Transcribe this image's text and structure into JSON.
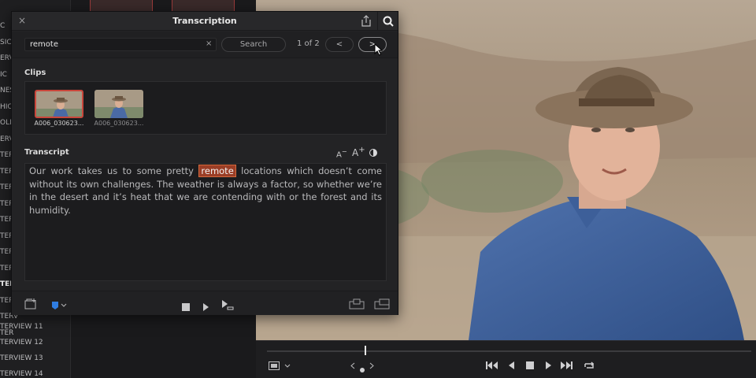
{
  "sidebar": {
    "items": [
      "C",
      "SIC",
      "ERVI",
      "IC",
      "NES",
      "HICS",
      "OLL",
      "ERVI",
      "TERV",
      "TERV",
      "TERV",
      "TERV",
      "TERV",
      "TERV",
      "TER",
      "TER",
      "TERV",
      "TERV",
      "TERV",
      "TER"
    ],
    "active_index": 16,
    "lower_items": [
      "TERVIEW 11",
      "TERVIEW 12",
      "TERVIEW 13",
      "TERVIEW 14"
    ]
  },
  "panel": {
    "title": "Transcription",
    "close_glyph": "×",
    "icons": {
      "share": "share-icon",
      "search": "search-icon"
    },
    "search": {
      "value": "remote",
      "clear_glyph": "×",
      "button_label": "Search",
      "result_count": "1 of 2",
      "prev_label": "<",
      "next_label": ">"
    },
    "clips": {
      "label": "Clips",
      "items": [
        {
          "name": "A006_030623...",
          "selected": true
        },
        {
          "name": "A006_030623...",
          "selected": false
        }
      ]
    },
    "transcript": {
      "label": "Transcript",
      "text_before": "Our work takes us to some pretty ",
      "highlight": "remote",
      "text_after": " locations which doesn’t come without its own challenges. The weather is always a factor, so whether we’re in the desert and it’s heat that we are contending with or the forest and its humidity.",
      "tools": {
        "decrease": "A",
        "increase": "A",
        "decrease_sup": "−",
        "increase_sup": "+"
      }
    },
    "footer_icons": [
      "add-bin-icon",
      "marker-icon",
      "stop-icon",
      "play-icon",
      "play-to-timeline-icon",
      "insert-clip-icon",
      "overwrite-clip-icon"
    ]
  },
  "transport": {
    "icons": [
      "viewer-mode-icon",
      "chevron-down-icon",
      "prev-icon",
      "dot-icon",
      "next-icon",
      "skip-back-icon",
      "reverse-play-icon",
      "stop-icon",
      "play-icon",
      "skip-forward-icon",
      "loop-icon"
    ],
    "playhead_fraction": 0.2
  },
  "colors": {
    "accent_red": "#c9463b",
    "highlight_bg": "#9b3e26",
    "panel_bg": "#232325",
    "marker_blue": "#2f7de1"
  }
}
